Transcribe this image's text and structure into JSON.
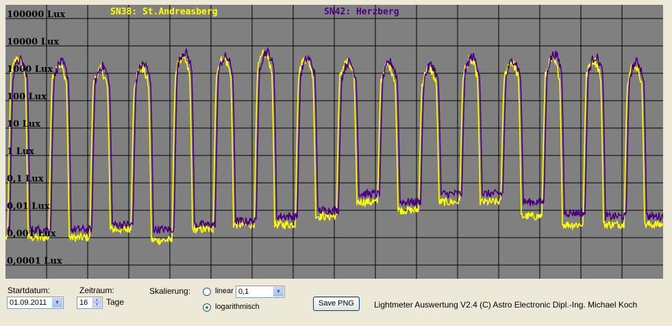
{
  "chart_data": {
    "type": "line",
    "yscale": "log",
    "ylim": [
      0.0001,
      100000
    ],
    "ytick_labels": [
      "100000 Lux",
      "10000 Lux",
      "1000 Lux",
      "100 Lux",
      "10 Lux",
      "1 Lux",
      "0,1 Lux",
      "0,01 Lux",
      "0,001 Lux",
      "0,0001 Lux"
    ],
    "days": 16,
    "grid": true,
    "legend": [
      "SN38: St.Andreasberg",
      "SN42: Herzberg"
    ],
    "series": [
      {
        "name": "SN38: St.Andreasberg",
        "color": "#ffff00",
        "day_peak_lux": [
          3500,
          2000,
          1300,
          1500,
          3500,
          3500,
          5000,
          3500,
          2500,
          2000,
          1500,
          3000,
          2500,
          3000,
          3000,
          2000
        ],
        "night_lux": [
          0.001,
          0.001,
          0.001,
          0.002,
          0.0008,
          0.002,
          0.003,
          0.003,
          0.006,
          0.02,
          0.01,
          0.02,
          0.02,
          0.006,
          0.003,
          0.003
        ]
      },
      {
        "name": "SN42: Herzberg",
        "color": "#4b0082",
        "day_peak_lux": [
          3000,
          2500,
          1800,
          2200,
          6000,
          4000,
          6000,
          3500,
          2500,
          2500,
          2000,
          4000,
          3000,
          5000,
          4000,
          2500
        ],
        "night_lux": [
          0.002,
          0.002,
          0.002,
          0.003,
          0.002,
          0.003,
          0.004,
          0.006,
          0.01,
          0.04,
          0.02,
          0.04,
          0.04,
          0.02,
          0.008,
          0.006
        ]
      }
    ]
  },
  "controls": {
    "startdatum_label": "Startdatum:",
    "startdatum_value": "01.09.2011",
    "zeitraum_label": "Zeitraum:",
    "zeitraum_value": "16",
    "tage_label": "Tage",
    "skalierung_label": "Skalierung:",
    "linear_label": "linear",
    "linear_value": "0,1",
    "log_label": "logarithmisch",
    "mode": "logarithmisch",
    "save_label": "Save PNG",
    "footer_text": "Lightmeter Auswertung V2.4  (C) Astro Electronic Dipl.-Ing. Michael Koch"
  },
  "colors": {
    "plot_bg": "#808080",
    "window_bg": "#ece9d8",
    "sn38": "#ffff00",
    "sn42": "#4b0082"
  }
}
